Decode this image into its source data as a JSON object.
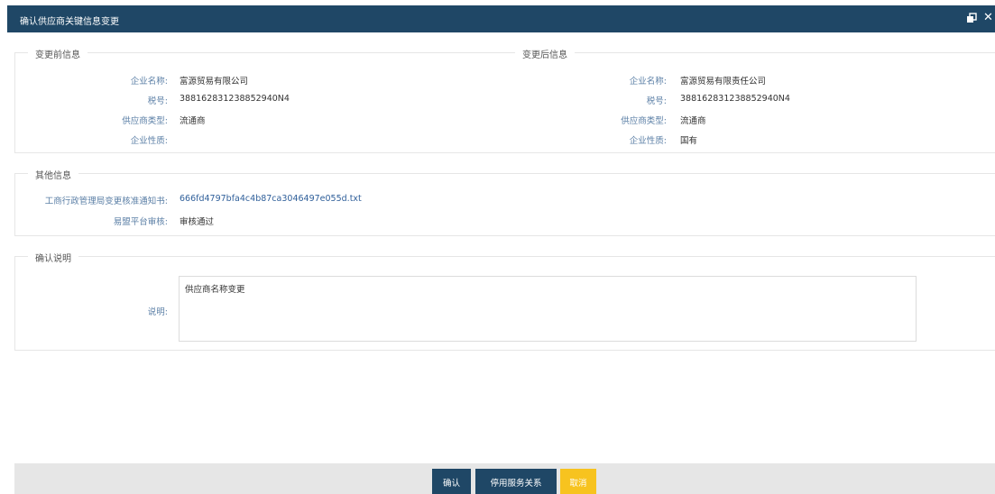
{
  "window": {
    "title": "确认供应商关键信息变更"
  },
  "icons": {
    "restore": "restore-window-icon",
    "close": "close-icon"
  },
  "before": {
    "legend": "变更前信息",
    "fields": [
      {
        "label": "企业名称:",
        "value": "富源贸易有限公司"
      },
      {
        "label": "税号:",
        "value": "388162831238852940N4"
      },
      {
        "label": "供应商类型:",
        "value": "流通商"
      },
      {
        "label": "企业性质:",
        "value": ""
      }
    ]
  },
  "after": {
    "legend": "变更后信息",
    "fields": [
      {
        "label": "企业名称:",
        "value": "富源贸易有限责任公司"
      },
      {
        "label": "税号:",
        "value": "388162831238852940N4"
      },
      {
        "label": "供应商类型:",
        "value": "流通商"
      },
      {
        "label": "企业性质:",
        "value": "国有"
      }
    ]
  },
  "other": {
    "legend": "其他信息",
    "notice_label": "工商行政管理局变更核准通知书:",
    "notice_file": "666fd4797bfa4c4b87ca3046497e055d.txt",
    "review_label": "易盟平台审核:",
    "review_value": "审核通过"
  },
  "confirm": {
    "legend": "确认说明",
    "note_label": "说明:",
    "note_value": "供应商名称变更"
  },
  "footer": {
    "confirm_label": "确认",
    "stop_label": "停用服务关系",
    "cancel_label": "取消"
  },
  "colors": {
    "header": "#1f4766",
    "primary_button": "#1f4766",
    "cancel_button": "#f7c31f",
    "label": "#5b7fa6",
    "link": "#2f5f9a"
  }
}
